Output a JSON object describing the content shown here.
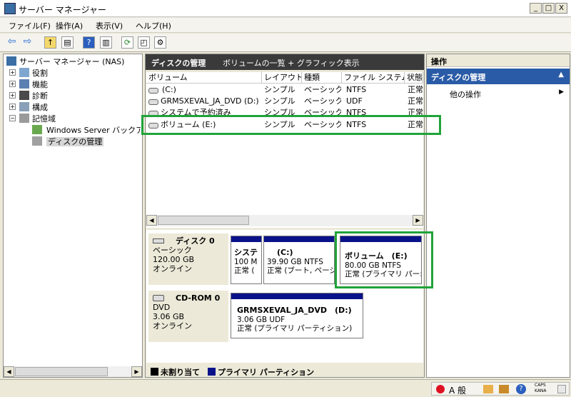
{
  "window": {
    "title": "サーバー マネージャー",
    "min": "_",
    "max": "□",
    "close": "X"
  },
  "menu": [
    "ファイル(F)",
    "操作(A)",
    "表示(V)",
    "ヘルプ(H)"
  ],
  "tree": {
    "root": "サーバー マネージャー (NAS)",
    "items": [
      "役割",
      "機能",
      "診断",
      "構成",
      "記憶域"
    ],
    "sub": [
      "Windows Server バックアップ",
      "ディスクの管理"
    ]
  },
  "center": {
    "title": "ディスクの管理",
    "subtitle": "ボリュームの一覧 + グラフィック表示",
    "columns": [
      "ボリューム",
      "レイアウト",
      "種類",
      "ファイル システム",
      "状態"
    ],
    "rows": [
      [
        "(C:)",
        "シンプル",
        "ベーシック",
        "NTFS",
        "正常"
      ],
      [
        "GRMSXEVAL_JA_DVD (D:)",
        "シンプル",
        "ベーシック",
        "UDF",
        "正常"
      ],
      [
        "システムで予約済み",
        "シンプル",
        "ベーシック",
        "NTFS",
        "正常"
      ],
      [
        "ボリューム (E:)",
        "シンプル",
        "ベーシック",
        "NTFS",
        "正常"
      ]
    ],
    "disk0": {
      "name": "ディスク 0",
      "type": "ベーシック",
      "size": "120.00 GB",
      "state": "オンライン"
    },
    "disk0_parts": [
      {
        "l1": "システ",
        "l2": "100 M",
        "l3": "正常 ("
      },
      {
        "l1": "(C:)",
        "l2": "39.90 GB NTFS",
        "l3": "正常 (ブート, ページ"
      },
      {
        "l1": "ボリューム　(E:)",
        "l2": "80.00 GB NTFS",
        "l3": "正常 (プライマリ パー:"
      }
    ],
    "cdrom": {
      "name": "CD-ROM 0",
      "type": "DVD",
      "size": "3.06 GB",
      "state": "オンライン"
    },
    "cdrom_part": {
      "l1": "GRMSXEVAL_JA_DVD　(D:)",
      "l2": "3.06 GB UDF",
      "l3": "正常 (プライマリ パーティション)"
    },
    "legend": {
      "unalloc": "未割り当て",
      "primary": "プライマリ パーティション"
    }
  },
  "actions": {
    "header": "操作",
    "section": "ディスクの管理",
    "item": "他の操作"
  },
  "status": {
    "caps": "CAPS",
    "kana": "KANA",
    "ime": "A 般"
  },
  "colors": {
    "highlight": "#21a33a",
    "partition_bar": "#0a128a",
    "section_header": "#2a5ba7"
  }
}
